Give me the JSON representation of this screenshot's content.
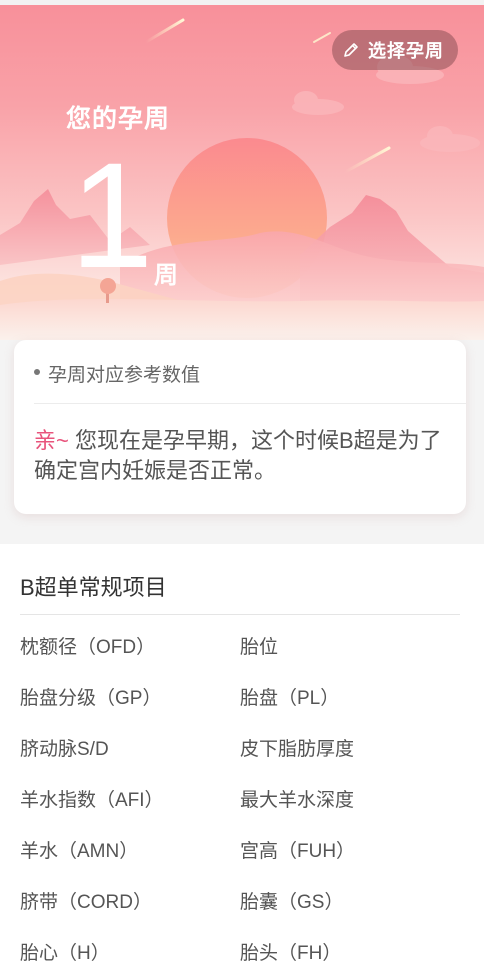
{
  "hero": {
    "select_week_label": "选择孕周",
    "week_title": "您的孕周",
    "week_number": "1",
    "week_unit": "周"
  },
  "reference": {
    "heading": "孕周对应参考数值",
    "greeting": "亲~",
    "message": " 您现在是孕早期，这个时候B超是为了确定宫内妊娠是否正常。"
  },
  "items_section": {
    "title": "B超单常规项目",
    "items": [
      "枕额径（OFD）",
      "胎位",
      "胎盘分级（GP）",
      "胎盘（PL）",
      "脐动脉S/D",
      "皮下脂肪厚度",
      "羊水指数（AFI）",
      "最大羊水深度",
      "羊水（AMN）",
      "宫高（FUH）",
      "脐带（CORD）",
      "胎囊（GS）",
      "胎心（H）",
      "胎头（FH）"
    ]
  },
  "colors": {
    "accent_pink": "#e8547c",
    "hero_top": "#f8909a",
    "sun": "#fbb08a"
  },
  "icons": [
    "pencil-icon"
  ]
}
